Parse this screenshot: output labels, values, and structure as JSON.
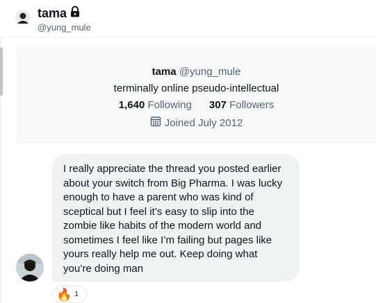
{
  "header": {
    "name": "tama",
    "handle": "@yung_mule",
    "lock_icon": "lock-icon"
  },
  "profile": {
    "name": "tama",
    "handle": "@yung_mule",
    "bio": "terminally online pseudo-intellectual",
    "following_count": "1,640",
    "following_label": "Following",
    "followers_count": "307",
    "followers_label": "Followers",
    "joined": "Joined July 2012",
    "joined_icon": "calendar-icon"
  },
  "message": {
    "text": "I really appreciate the thread you posted earlier about your switch from Big Pharma. I was lucky enough to have a parent who was kind of sceptical but I feel it’s easy to slip into the zombie like habits of the modern world and sometimes I feel like I’m failing but pages like yours really help me out. Keep doing what you’re doing man"
  },
  "reaction": {
    "emoji": "🔥",
    "count": "1"
  },
  "colors": {
    "text": "#0f1419",
    "secondary": "#536471",
    "bubble": "#eff3f4",
    "card": "#f7f9f9"
  }
}
